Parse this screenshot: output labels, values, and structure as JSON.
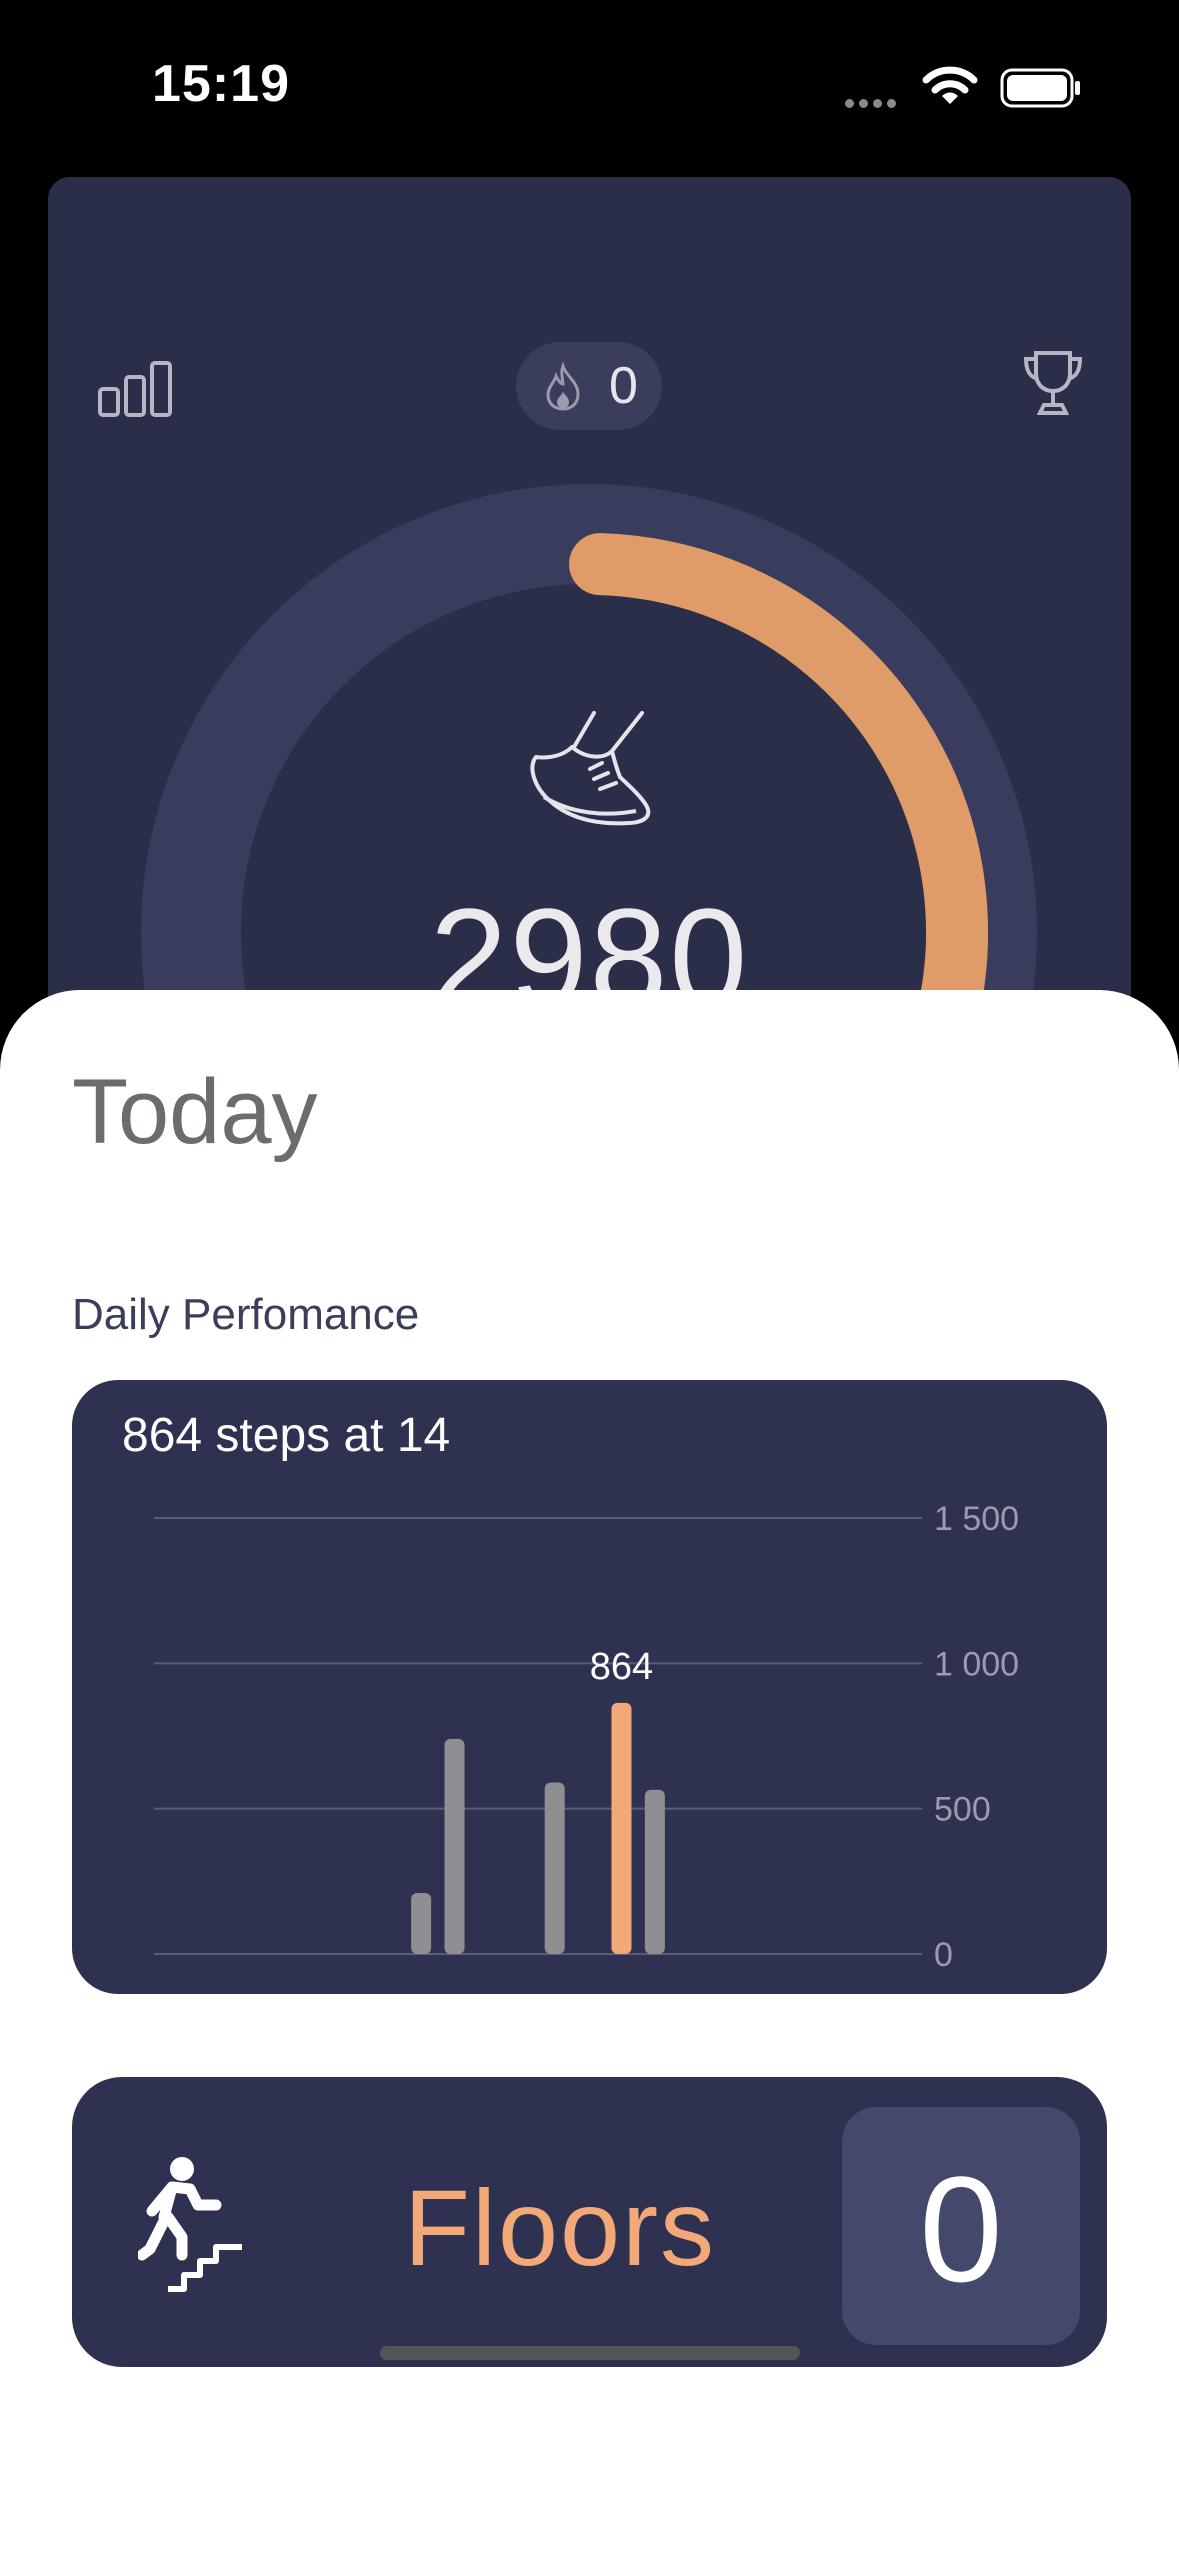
{
  "status_bar": {
    "time": "15:19",
    "icons": [
      "signal-dots-icon",
      "wifi-icon",
      "battery-icon"
    ]
  },
  "top_card": {
    "streak_count": "0",
    "steps": "2980",
    "goal_progress_fraction": 0.3,
    "icons": [
      "bar-chart-icon",
      "flame-icon",
      "trophy-icon",
      "shoe-icon"
    ]
  },
  "sheet": {
    "title": "Today",
    "section_label": "Daily Perfomance",
    "headline": "864 steps at 14"
  },
  "chart_data": {
    "type": "bar",
    "highlight_label": "864",
    "highlight_hour": 14,
    "ylim": [
      0,
      1500
    ],
    "y_ticks": [
      {
        "value": 1500,
        "label": "1 500"
      },
      {
        "value": 1000,
        "label": "1 000"
      },
      {
        "value": 500,
        "label": "500"
      },
      {
        "value": 0,
        "label": "0"
      }
    ],
    "x_range": [
      0,
      23
    ],
    "bars": [
      {
        "hour": 8,
        "value": 210,
        "highlight": false
      },
      {
        "hour": 9,
        "value": 740,
        "highlight": false
      },
      {
        "hour": 12,
        "value": 590,
        "highlight": false
      },
      {
        "hour": 14,
        "value": 864,
        "highlight": true
      },
      {
        "hour": 15,
        "value": 565,
        "highlight": false
      }
    ]
  },
  "floors": {
    "label": "Floors",
    "count": "0"
  },
  "colors": {
    "accent": "#f3a877",
    "ring_progress": "#df9c69",
    "card_bg": "#2e3150",
    "bar_gray": "#8e8e93"
  }
}
